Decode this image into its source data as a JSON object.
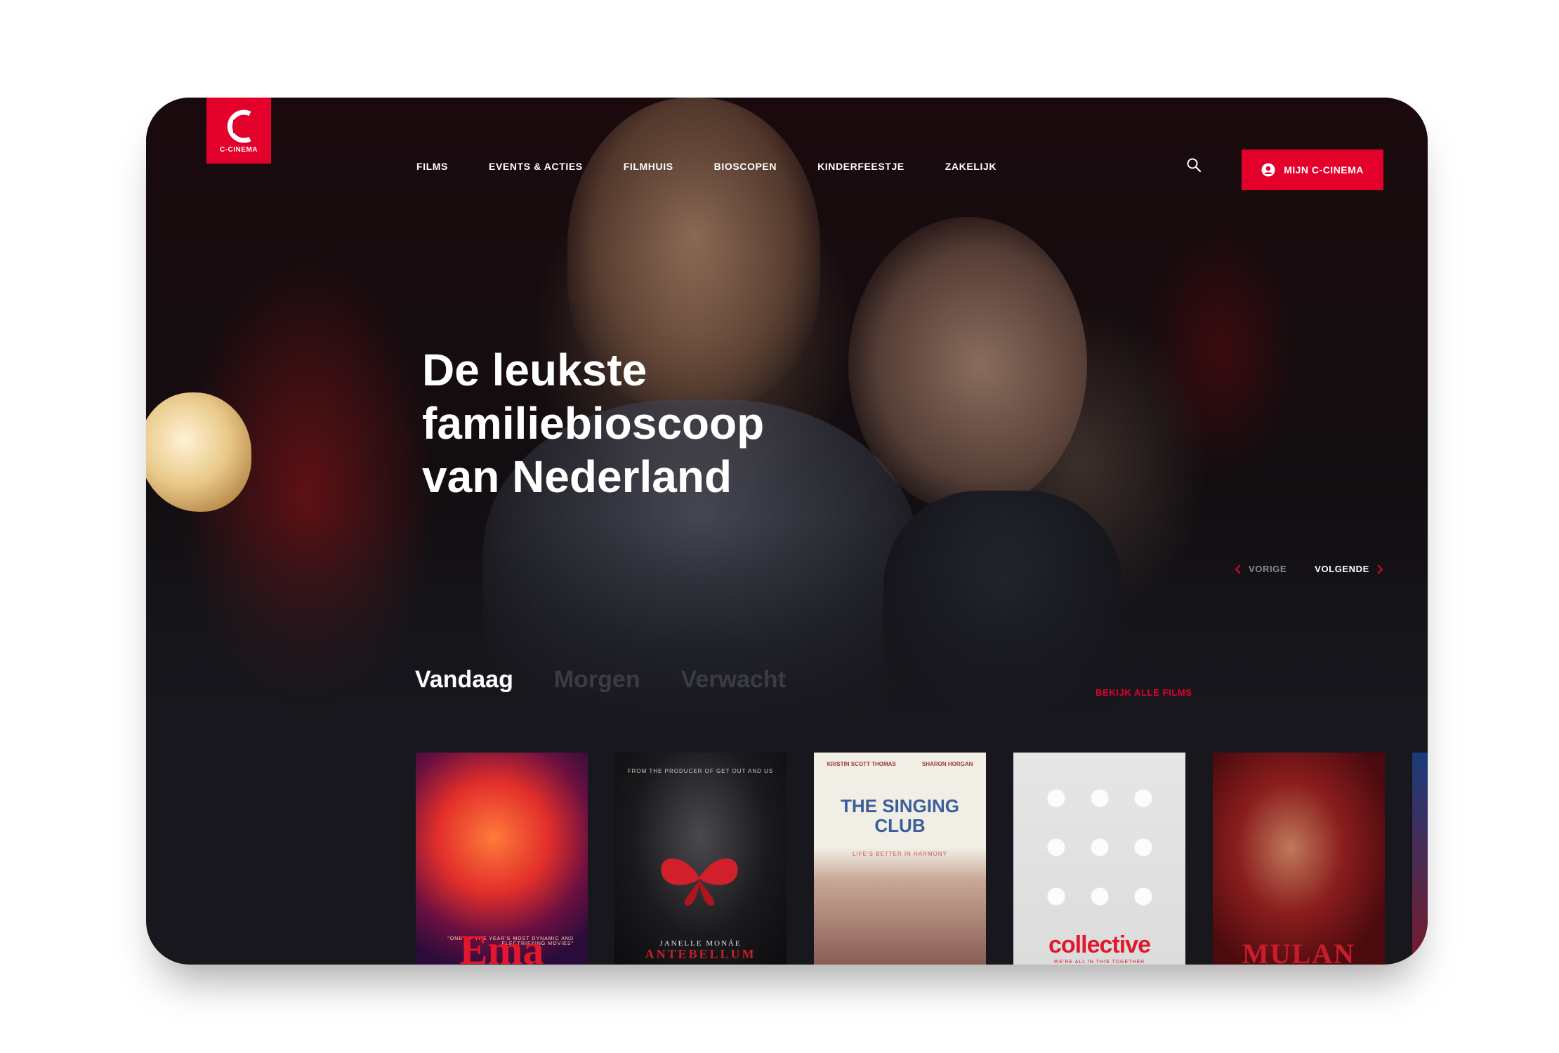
{
  "brand": {
    "name": "C-CINEMA",
    "accent": "#e3002b",
    "background": "#17171d"
  },
  "nav": {
    "items": [
      "FILMS",
      "EVENTS & ACTIES",
      "FILMHUIS",
      "BIOSCOPEN",
      "KINDERFEESTJE",
      "ZAKELIJK"
    ],
    "search_icon": "search-icon",
    "account_button": "MIJN C-CINEMA",
    "account_icon": "user-circle-icon"
  },
  "hero": {
    "title_lines": [
      "De leukste",
      "familiebioscoop",
      "van Nederland"
    ],
    "prev_label": "VORIGE",
    "next_label": "VOLGENDE"
  },
  "schedule": {
    "tabs": [
      "Vandaag",
      "Morgen",
      "Verwacht"
    ],
    "active_tab": "Vandaag",
    "view_all": "BEKIJK ALLE FILMS"
  },
  "posters": [
    {
      "title": "Ema",
      "tagline": "\"ONE OF THE YEAR'S MOST DYNAMIC AND ELECTRIFYING MOVIES\""
    },
    {
      "title": "ANTEBELLUM",
      "subtitle": "JANELLE MONÁE",
      "tagline": "FROM THE PRODUCER OF GET OUT AND US"
    },
    {
      "title": "THE SINGING CLUB",
      "tagline": "LIFE'S BETTER IN HARMONY",
      "names": [
        "KRISTIN SCOTT THOMAS",
        "SHARON HORGAN"
      ]
    },
    {
      "title": "collective",
      "tagline": "WE'RE ALL IN THIS TOGETHER"
    },
    {
      "title": "MULAN"
    }
  ]
}
